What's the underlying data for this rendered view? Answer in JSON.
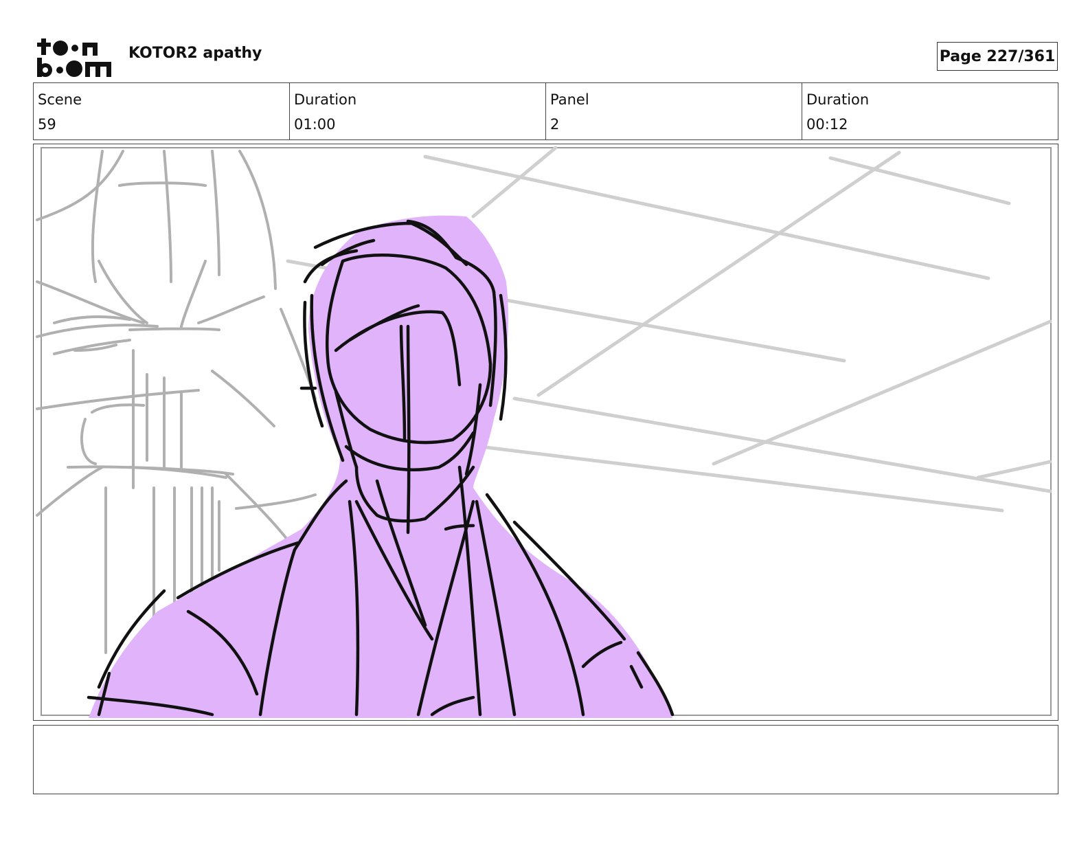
{
  "header": {
    "logo_alt": "toon boom",
    "project_title": "KOTOR2 apathy",
    "page_label": "Page 227/361"
  },
  "info": {
    "scene_label": "Scene",
    "scene_value": "59",
    "scene_duration_label": "Duration",
    "scene_duration_value": "01:00",
    "panel_label": "Panel",
    "panel_value": "2",
    "panel_duration_label": "Duration",
    "panel_duration_value": "00:12"
  },
  "panel": {
    "fill_color": "#e0b3fa",
    "line_color": "#111111",
    "background_line_color": "#bdbdbd"
  },
  "notes": {
    "text": ""
  }
}
